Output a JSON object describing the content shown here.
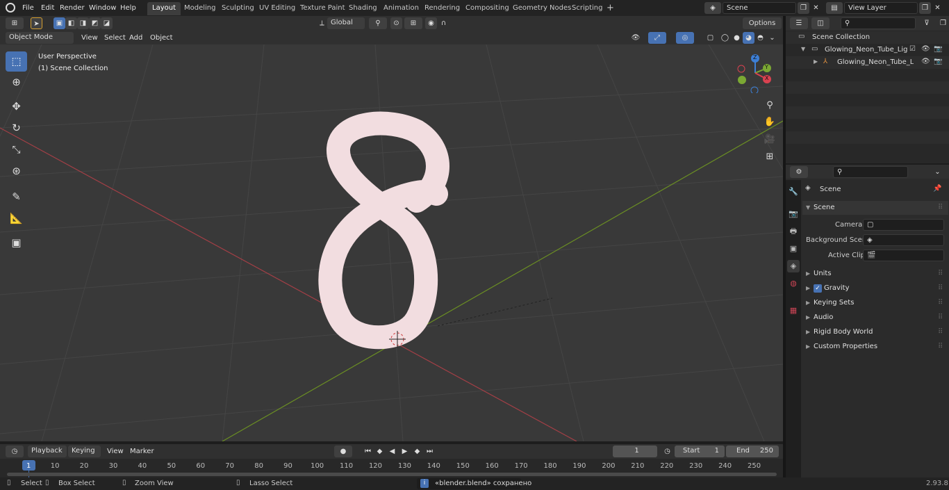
{
  "menu": [
    "File",
    "Edit",
    "Render",
    "Window",
    "Help"
  ],
  "workspaces": [
    "Layout",
    "Modeling",
    "Sculpting",
    "UV Editing",
    "Texture Paint",
    "Shading",
    "Animation",
    "Rendering",
    "Compositing",
    "Geometry Nodes",
    "Scripting"
  ],
  "scene_field": "Scene",
  "view_layer_field": "View Layer",
  "transform": {
    "orientation": "Global",
    "options": "Options"
  },
  "header": {
    "mode": "Object Mode",
    "items": [
      "View",
      "Select",
      "Add",
      "Object"
    ]
  },
  "viewport": {
    "perspective": "User Perspective",
    "collection": "(1) Scene Collection"
  },
  "gizmo": {
    "x": "X",
    "y": "Y",
    "z": "Z"
  },
  "outliner": {
    "root": "Scene Collection",
    "items": [
      "Glowing_Neon_Tube_Light_Di",
      "Glowing_Neon_Tube_Ligl"
    ]
  },
  "properties": {
    "context": "Scene",
    "panel": "Scene",
    "fields": [
      {
        "label": "Camera"
      },
      {
        "label": "Background Scene"
      },
      {
        "label": "Active Clip"
      }
    ],
    "sections": [
      "Units",
      "Gravity",
      "Keying Sets",
      "Audio",
      "Rigid Body World",
      "Custom Properties"
    ]
  },
  "timeline": {
    "menus": [
      "Playback",
      "Keying",
      "View",
      "Marker"
    ],
    "current_frame": "1",
    "start_label": "Start",
    "start": "1",
    "end_label": "End",
    "end": "250",
    "ticks": [
      "1",
      "10",
      "20",
      "30",
      "40",
      "50",
      "60",
      "70",
      "80",
      "90",
      "100",
      "110",
      "120",
      "130",
      "140",
      "150",
      "160",
      "170",
      "180",
      "190",
      "200",
      "210",
      "220",
      "230",
      "240",
      "250"
    ]
  },
  "status": {
    "select": "Select",
    "box_select": "Box Select",
    "zoom_view": "Zoom View",
    "lasso_select": "Lasso Select",
    "message": "«blender.blend» сохранено",
    "version": "2.93.8"
  }
}
